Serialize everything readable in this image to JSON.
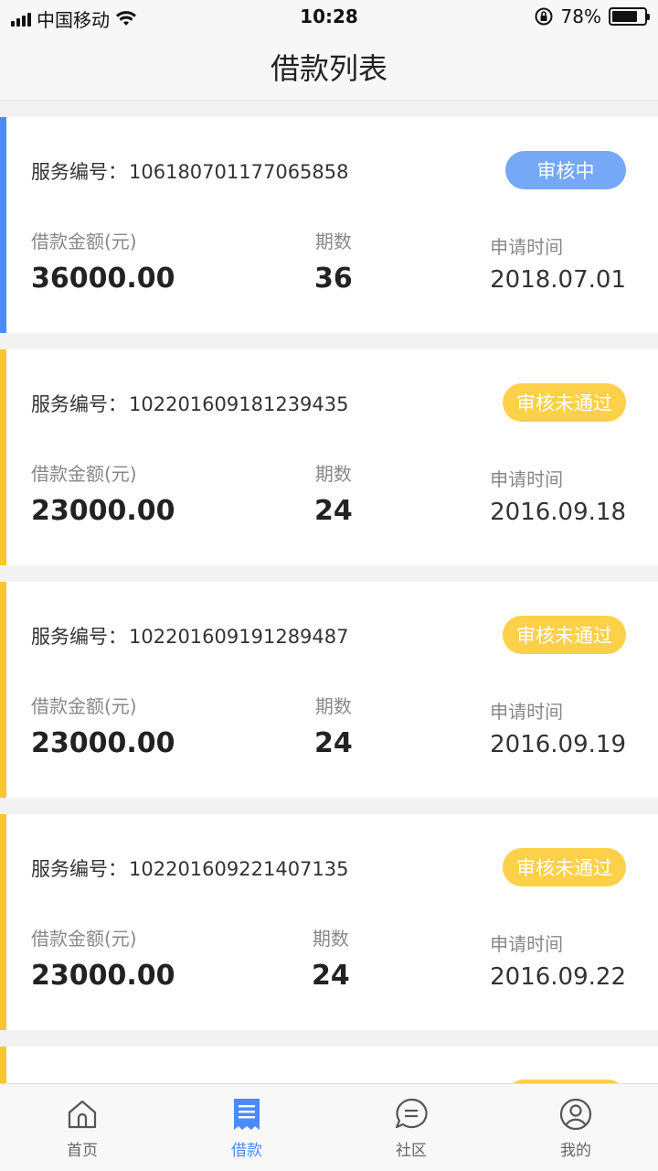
{
  "status_bar": {
    "carrier": "中国移动",
    "time": "10:28",
    "battery": "78%",
    "battery_level": 0.78
  },
  "nav": {
    "title": "借款列表"
  },
  "colors": {
    "accent": "#4a8cff",
    "badge_review": "#75a8f6",
    "badge_rejected": "#fdd04a",
    "rejected_stripe": "#f8c82c"
  },
  "labels": {
    "service": "服务编号：",
    "amount": "借款金额(元)",
    "term": "期数",
    "date": "申请时间"
  },
  "loans": [
    {
      "service_no": "106180701177065858",
      "status": "审核中",
      "amount": "36000.00",
      "term": "36",
      "date": "2018.07.01"
    },
    {
      "service_no": "102201609181239435",
      "status": "审核未通过",
      "amount": "23000.00",
      "term": "24",
      "date": "2016.09.18"
    },
    {
      "service_no": "102201609191289487",
      "status": "审核未通过",
      "amount": "23000.00",
      "term": "24",
      "date": "2016.09.19"
    },
    {
      "service_no": "102201609221407135",
      "status": "审核未通过",
      "amount": "23000.00",
      "term": "24",
      "date": "2016.09.22"
    }
  ],
  "tabs": [
    {
      "label": "首页",
      "icon": "home-icon"
    },
    {
      "label": "借款",
      "icon": "loan-receipt-icon"
    },
    {
      "label": "社区",
      "icon": "community-chat-icon"
    },
    {
      "label": "我的",
      "icon": "user-profile-icon"
    }
  ]
}
